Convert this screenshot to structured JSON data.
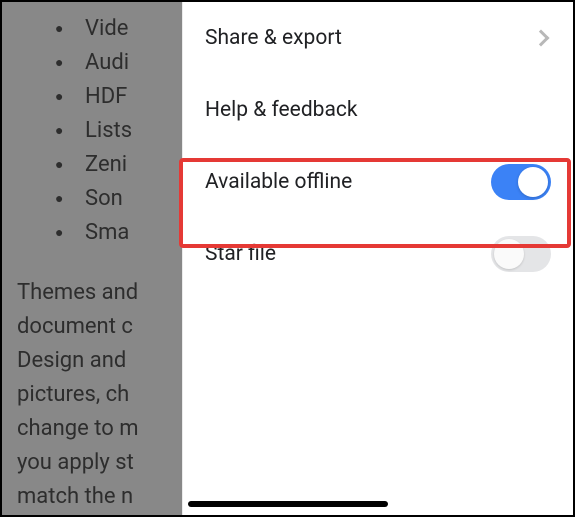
{
  "document": {
    "bullets": [
      "Vide",
      "Audi",
      "HDF",
      "Lists",
      "Zeni",
      "Son",
      "Sma"
    ],
    "paragraph_lines": [
      "Themes and",
      "document c",
      "Design and",
      "pictures, ch",
      "change to m",
      "you apply st",
      "match the n"
    ]
  },
  "panel": {
    "share_export": "Share & export",
    "help_feedback": "Help & feedback",
    "available_offline": "Available offline",
    "star_file": "Star file",
    "toggles": {
      "available_offline": true,
      "star_file": false
    }
  }
}
